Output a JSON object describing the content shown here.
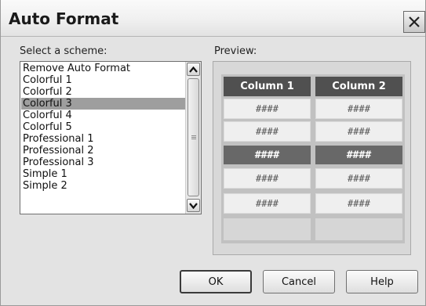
{
  "window": {
    "title": "Auto Format"
  },
  "scheme_list": {
    "label": "Select a scheme:",
    "items": [
      "Remove Auto Format",
      "Colorful 1",
      "Colorful 2",
      "Colorful 3",
      "Colorful 4",
      "Colorful 5",
      "Professional 1",
      "Professional 2",
      "Professional 3",
      "Simple 1",
      "Simple 2"
    ],
    "selected": "Colorful 3"
  },
  "preview": {
    "label": "Preview:",
    "headers": [
      "Column 1",
      "Column 2"
    ],
    "rows": [
      [
        "####",
        "####"
      ],
      [
        "####",
        "####"
      ],
      [
        "####",
        "####"
      ],
      [
        "####",
        "####"
      ],
      [
        "####",
        "####"
      ],
      [
        "",
        ""
      ]
    ]
  },
  "buttons": {
    "ok": "OK",
    "cancel": "Cancel",
    "help": "Help"
  }
}
